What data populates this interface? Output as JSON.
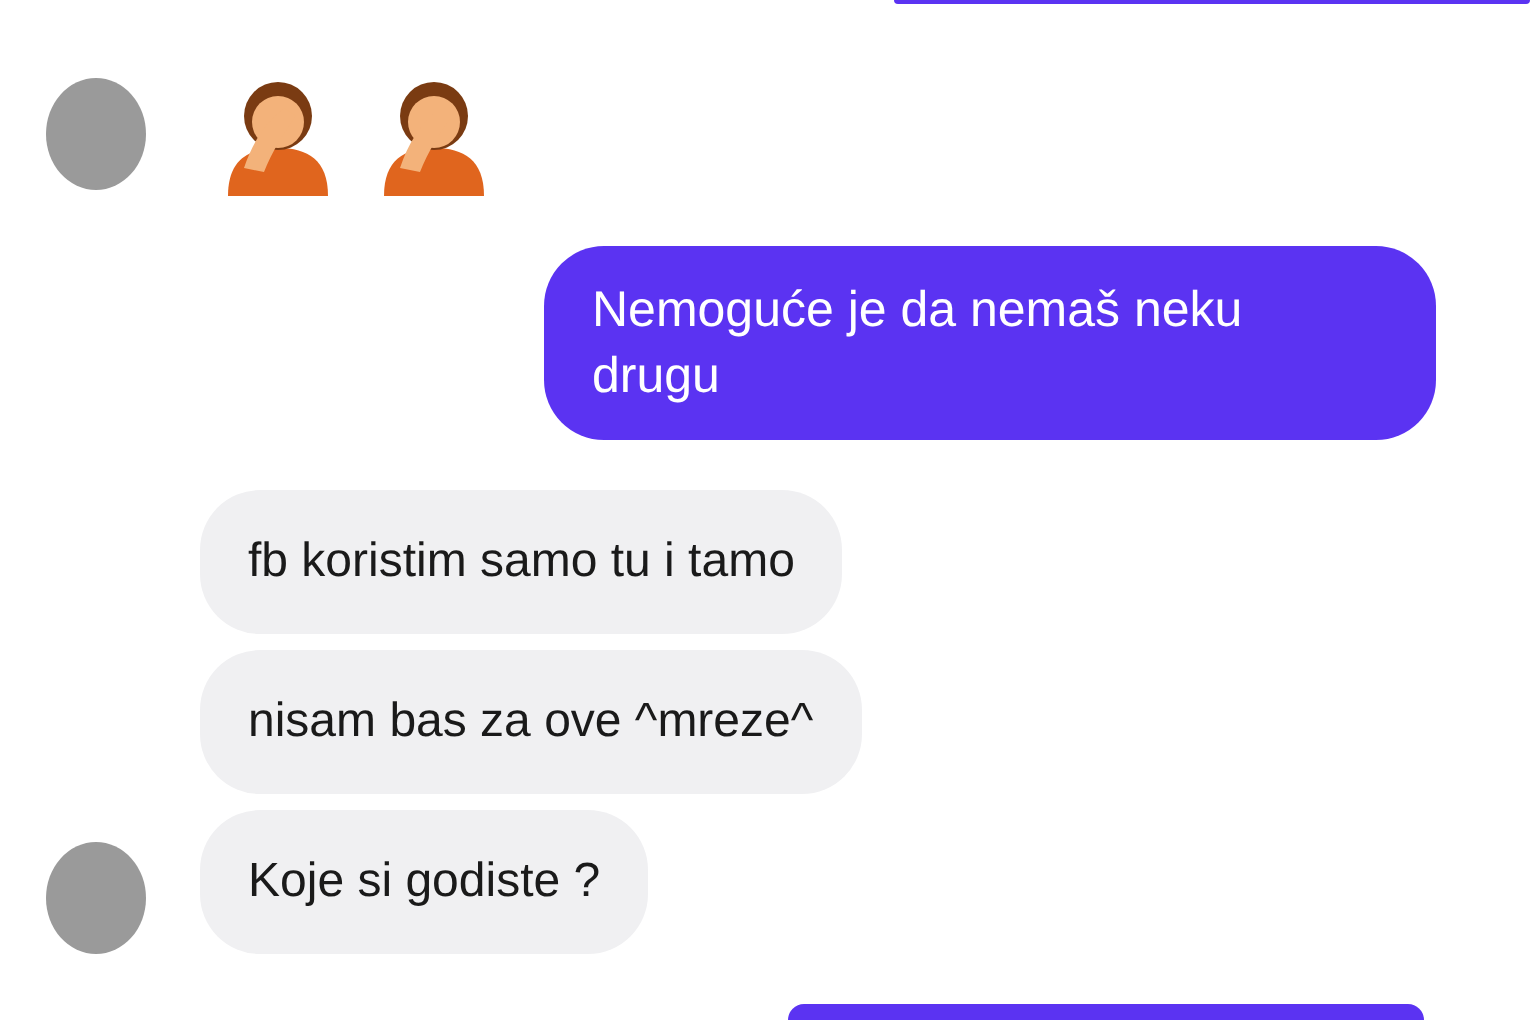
{
  "messages": [
    {
      "kind": "sent-partial-top"
    },
    {
      "kind": "emoji-row",
      "avatar": true,
      "emojis": [
        {
          "kind": "facepalm"
        },
        {
          "kind": "facepalm"
        }
      ]
    },
    {
      "kind": "sent",
      "text": "Nemoguće je da nemaš neku drugu"
    },
    {
      "kind": "received",
      "avatar": false,
      "text": "fb koristim samo tu i tamo"
    },
    {
      "kind": "received",
      "avatar": false,
      "text": "nisam bas za ove ^mreze^"
    },
    {
      "kind": "received",
      "avatar": true,
      "text": "Koje si godiste ?"
    },
    {
      "kind": "sent-partial-bottom"
    }
  ]
}
